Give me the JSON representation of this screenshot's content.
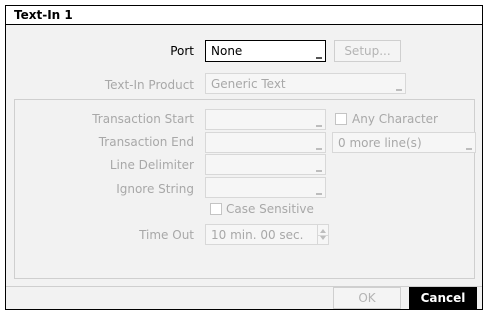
{
  "dialog": {
    "title": "Text-In 1",
    "port": {
      "label": "Port",
      "value": "None"
    },
    "setup_button": "Setup...",
    "product": {
      "label": "Text-In Product",
      "value": "Generic Text"
    },
    "transaction_start": {
      "label": "Transaction Start",
      "value": ""
    },
    "any_character": {
      "label": "Any Character",
      "checked": false
    },
    "transaction_end": {
      "label": "Transaction End",
      "value": ""
    },
    "more_lines": {
      "value": "0 more line(s)"
    },
    "line_delimiter": {
      "label": "Line Delimiter",
      "value": ""
    },
    "ignore_string": {
      "label": "Ignore String",
      "value": ""
    },
    "case_sensitive": {
      "label": "Case Sensitive",
      "checked": false
    },
    "time_out": {
      "label": "Time Out",
      "value": "10 min. 00 sec."
    },
    "ok_button": "OK",
    "cancel_button": "Cancel"
  }
}
